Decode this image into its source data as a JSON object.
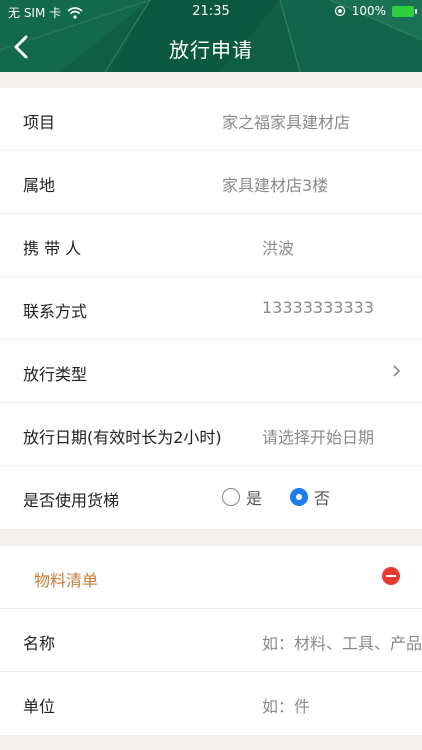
{
  "status_bar": {
    "carrier": "无 SIM 卡",
    "time": "21:35",
    "battery": "100%"
  },
  "header": {
    "title": "放行申请"
  },
  "form": {
    "project_label": "项目",
    "project_value": "家之福家具建材店",
    "location_label": "属地",
    "location_value": "家具建材店3楼",
    "carrier_label": "携 带 人",
    "carrier_value": "洪波",
    "contact_label": "联系方式",
    "contact_value": "13333333333",
    "type_label": "放行类型",
    "date_label": "放行日期(有效时长为2小时)",
    "date_placeholder": "请选择开始日期",
    "elevator_label": "是否使用货梯",
    "elevator_yes": "是",
    "elevator_no": "否",
    "elevator_selected": "否"
  },
  "materials": {
    "title": "物料清单",
    "name_label": "名称",
    "name_placeholder": "如：材料、工具、产品",
    "unit_label": "单位",
    "unit_placeholder": "如：件"
  },
  "colors": {
    "header_bg": "#0f5f45",
    "accent_blue": "#1e7df0",
    "materials_title": "#c77a38",
    "remove_red": "#ea3b33"
  }
}
